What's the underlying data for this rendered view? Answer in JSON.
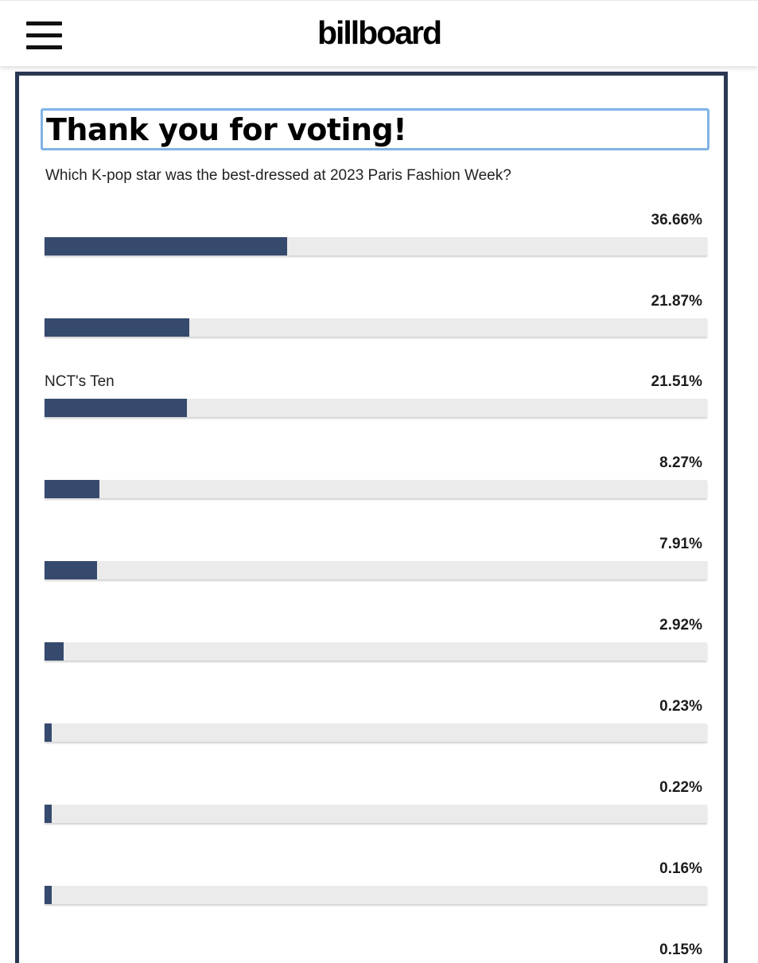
{
  "header": {
    "logo": "billboard",
    "menu_icon": "hamburger-menu-icon"
  },
  "poll": {
    "heading": "Thank you for voting!",
    "question": "Which K-pop star was the best-dressed at 2023 Paris Fashion Week?",
    "options": [
      {
        "label": "",
        "percent_text": "36.66%",
        "percent": 36.66
      },
      {
        "label": "",
        "percent_text": "21.87%",
        "percent": 21.87
      },
      {
        "label": "NCT's Ten",
        "percent_text": "21.51%",
        "percent": 21.51
      },
      {
        "label": "",
        "percent_text": "8.27%",
        "percent": 8.27
      },
      {
        "label": "",
        "percent_text": "7.91%",
        "percent": 7.91
      },
      {
        "label": "",
        "percent_text": "2.92%",
        "percent": 2.92
      },
      {
        "label": "",
        "percent_text": "0.23%",
        "percent": 0.23
      },
      {
        "label": "",
        "percent_text": "0.22%",
        "percent": 0.22
      },
      {
        "label": "",
        "percent_text": "0.16%",
        "percent": 0.16
      },
      {
        "label": "",
        "percent_text": "0.15%",
        "percent": 0.15
      }
    ]
  },
  "colors": {
    "bar_fill": "#364a6e",
    "bar_track": "#ebebeb",
    "frame_border": "#2b3853",
    "heading_focus_outline": "#7fb3e6"
  }
}
